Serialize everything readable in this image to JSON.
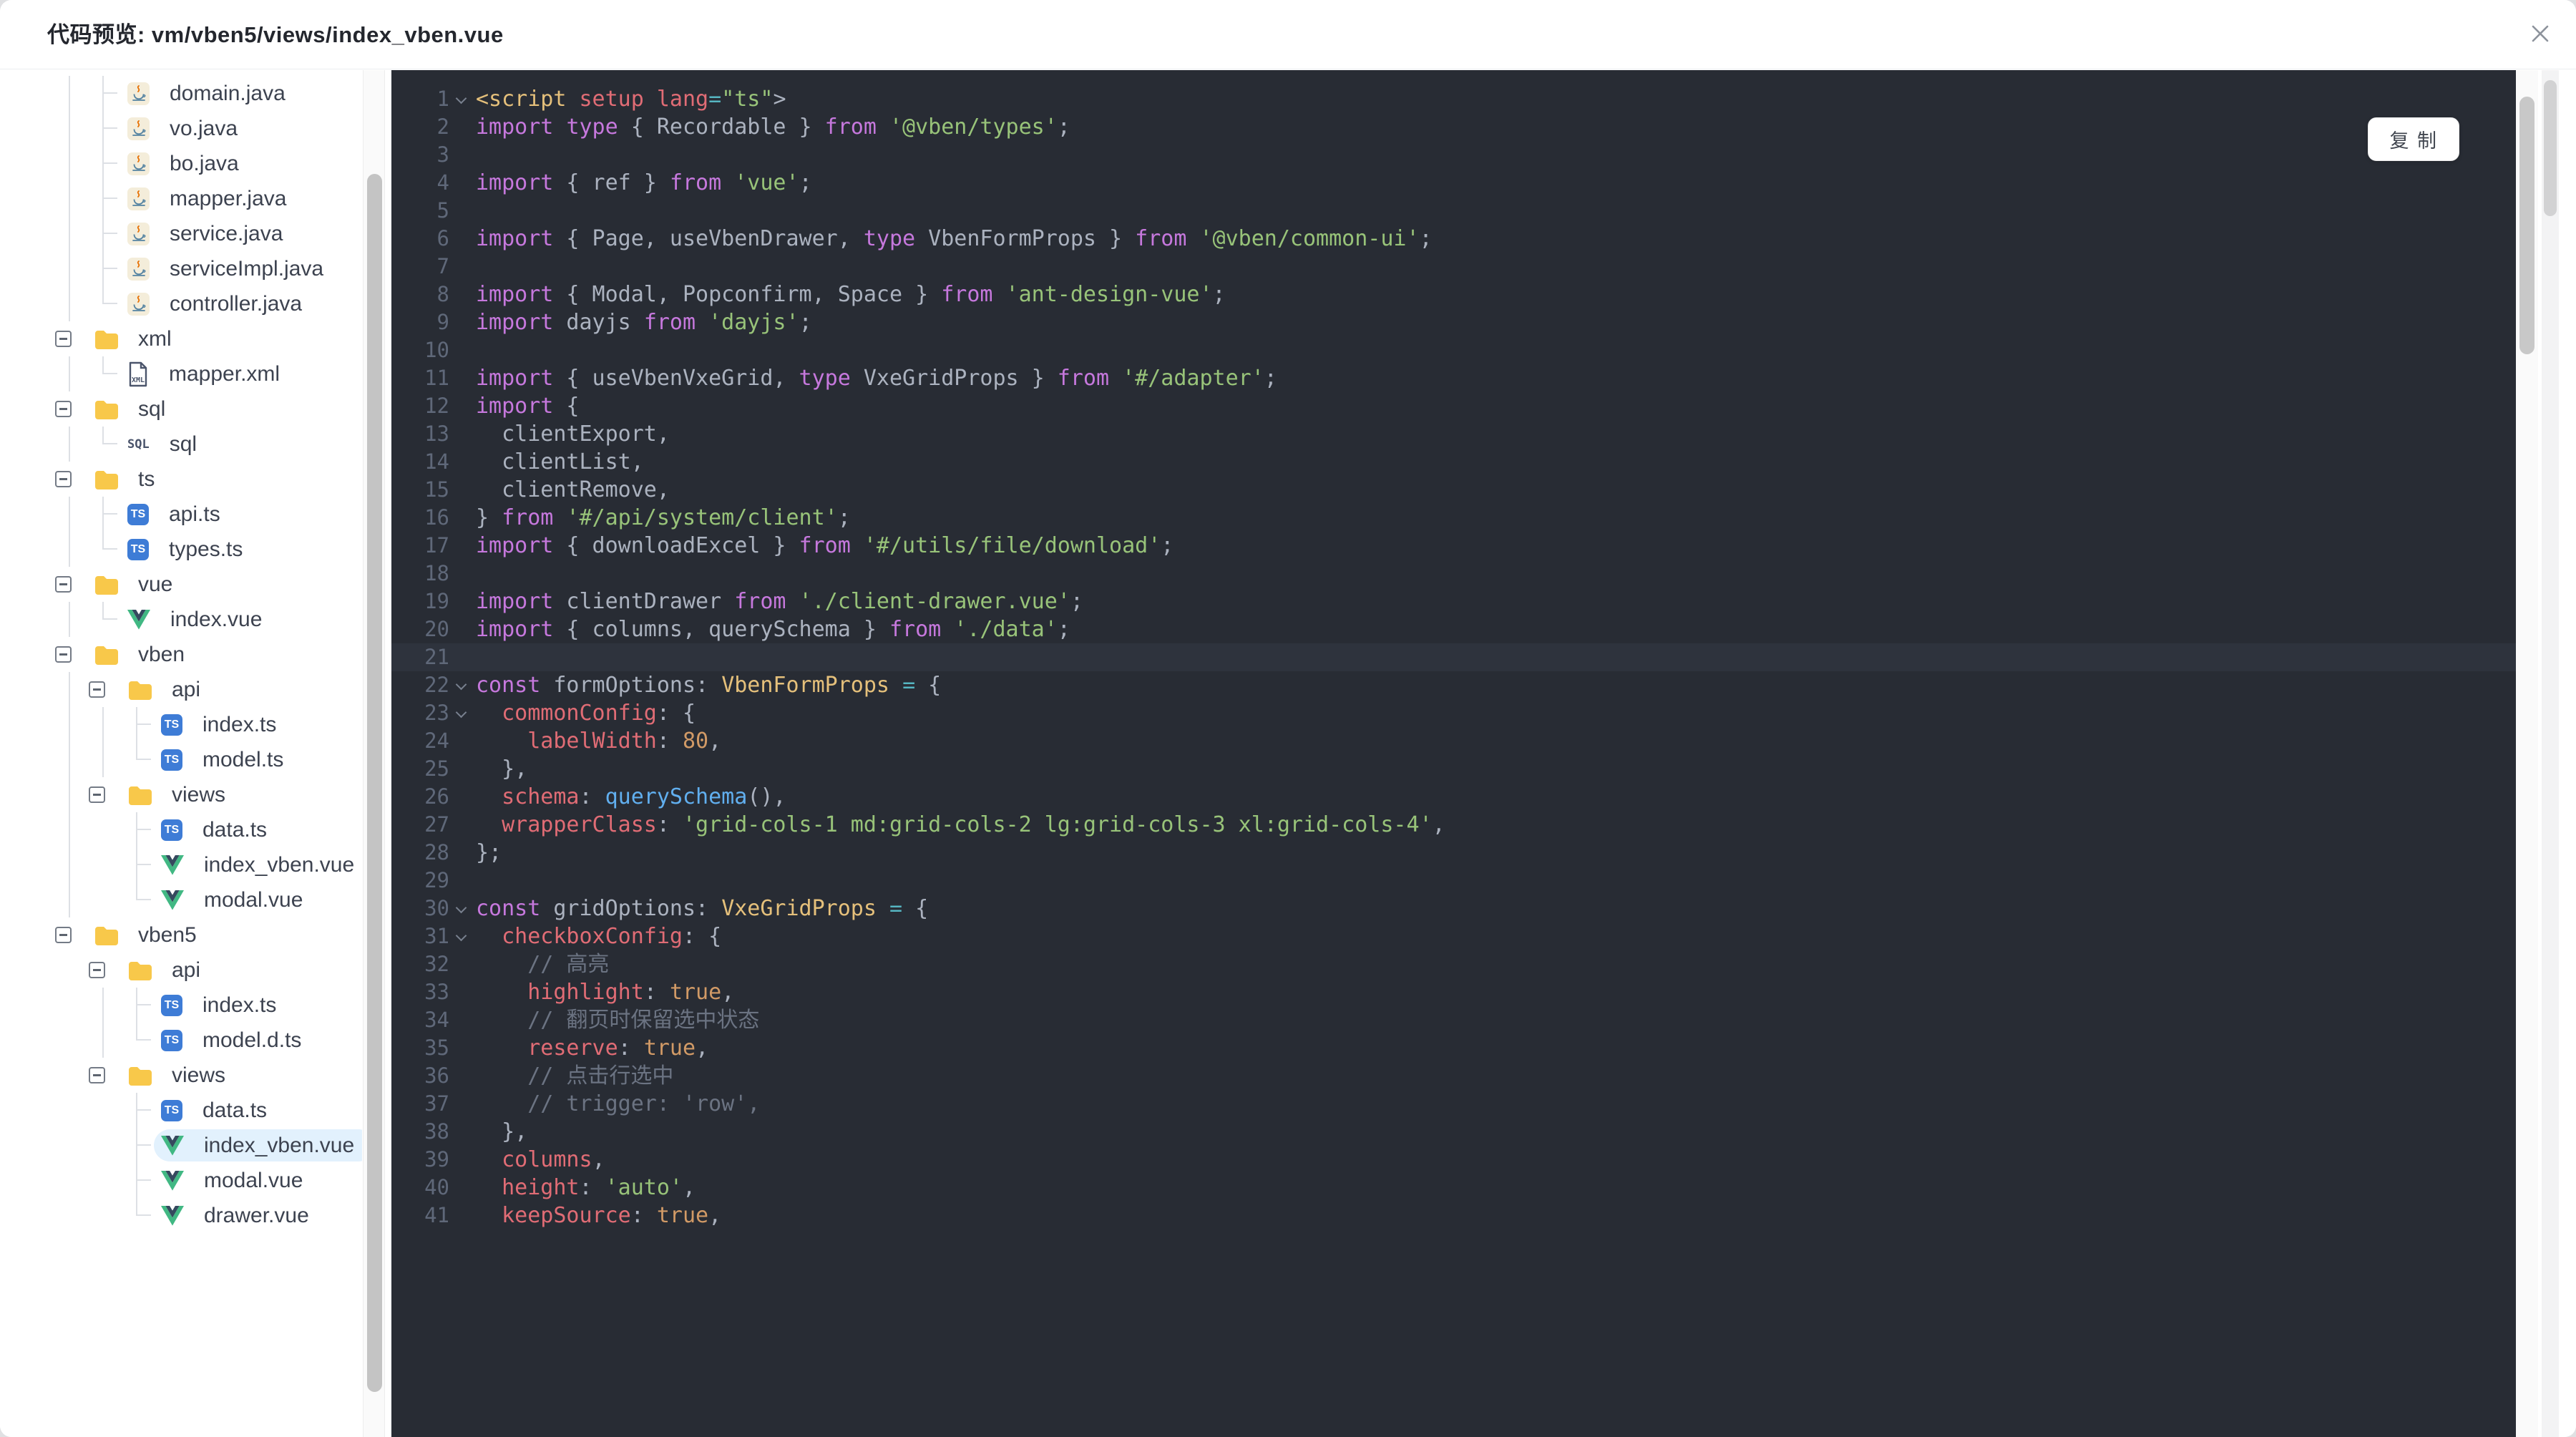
{
  "window": {
    "title": "代码预览: vm/vben5/views/index_vben.vue"
  },
  "colors": {
    "code_bg": "#282c34",
    "cursor_line_bg": "#2e333d",
    "line_number": "#5f6879",
    "keyword": "#c678dd",
    "string": "#98c379",
    "property": "#e06c75",
    "number": "#d19a66",
    "type": "#e5c07b",
    "function": "#61afef",
    "operator": "#56b6c2",
    "comment": "#6b7382",
    "default_text": "#abb2bf",
    "folder_icon": "#f8c84a",
    "ts_icon": "#3e7cd6",
    "vue_icon_green": "#41b883",
    "vue_icon_navy": "#35495e",
    "selected_row_bg": "#e2f1fd"
  },
  "tree": {
    "items": [
      {
        "label": "domain.java",
        "icon": "java-icon",
        "level": 1,
        "conn": "tee",
        "guides": [
          0
        ]
      },
      {
        "label": "vo.java",
        "icon": "java-icon",
        "level": 1,
        "conn": "tee",
        "guides": [
          0
        ]
      },
      {
        "label": "bo.java",
        "icon": "java-icon",
        "level": 1,
        "conn": "tee",
        "guides": [
          0
        ]
      },
      {
        "label": "mapper.java",
        "icon": "java-icon",
        "level": 1,
        "conn": "tee",
        "guides": [
          0
        ]
      },
      {
        "label": "service.java",
        "icon": "java-icon",
        "level": 1,
        "conn": "tee",
        "guides": [
          0
        ]
      },
      {
        "label": "serviceImpl.java",
        "icon": "java-icon",
        "level": 1,
        "conn": "tee",
        "guides": [
          0
        ]
      },
      {
        "label": "controller.java",
        "icon": "java-icon",
        "level": 1,
        "conn": "corner",
        "guides": [
          0
        ]
      },
      {
        "label": "xml",
        "icon": "folder-icon",
        "level": 0,
        "expander": true,
        "guides": []
      },
      {
        "label": "mapper.xml",
        "icon": "xml-icon",
        "level": 1,
        "conn": "corner",
        "guides": [
          0
        ]
      },
      {
        "label": "sql",
        "icon": "folder-icon",
        "level": 0,
        "expander": true,
        "guides": []
      },
      {
        "label": "sql",
        "icon": "sql-icon",
        "level": 1,
        "conn": "corner",
        "guides": [
          0
        ]
      },
      {
        "label": "ts",
        "icon": "folder-icon",
        "level": 0,
        "expander": true,
        "guides": []
      },
      {
        "label": "api.ts",
        "icon": "ts-icon",
        "level": 1,
        "conn": "tee",
        "guides": [
          0
        ]
      },
      {
        "label": "types.ts",
        "icon": "ts-icon",
        "level": 1,
        "conn": "corner",
        "guides": [
          0
        ]
      },
      {
        "label": "vue",
        "icon": "folder-icon",
        "level": 0,
        "expander": true,
        "guides": []
      },
      {
        "label": "index.vue",
        "icon": "vue-icon",
        "level": 1,
        "conn": "corner",
        "guides": [
          0
        ]
      },
      {
        "label": "vben",
        "icon": "folder-icon",
        "level": 0,
        "expander": true,
        "guides": []
      },
      {
        "label": "api",
        "icon": "folder-icon",
        "level": 1,
        "expander": true,
        "guides": [
          0
        ]
      },
      {
        "label": "index.ts",
        "icon": "ts-icon",
        "level": 2,
        "conn": "tee",
        "guides": [
          0,
          1
        ]
      },
      {
        "label": "model.ts",
        "icon": "ts-icon",
        "level": 2,
        "conn": "corner",
        "guides": [
          0,
          1
        ]
      },
      {
        "label": "views",
        "icon": "folder-icon",
        "level": 1,
        "expander": true,
        "guides": [
          0
        ]
      },
      {
        "label": "data.ts",
        "icon": "ts-icon",
        "level": 2,
        "conn": "tee",
        "guides": [
          0
        ]
      },
      {
        "label": "index_vben.vue",
        "icon": "vue-icon",
        "level": 2,
        "conn": "tee",
        "guides": [
          0
        ]
      },
      {
        "label": "modal.vue",
        "icon": "vue-icon",
        "level": 2,
        "conn": "corner",
        "guides": [
          0
        ]
      },
      {
        "label": "vben5",
        "icon": "folder-icon",
        "level": 0,
        "expander": true,
        "guides": []
      },
      {
        "label": "api",
        "icon": "folder-icon",
        "level": 1,
        "expander": true,
        "guides": []
      },
      {
        "label": "index.ts",
        "icon": "ts-icon",
        "level": 2,
        "conn": "tee",
        "guides": [
          1
        ]
      },
      {
        "label": "model.d.ts",
        "icon": "ts-icon",
        "level": 2,
        "conn": "corner",
        "guides": [
          1
        ]
      },
      {
        "label": "views",
        "icon": "folder-icon",
        "level": 1,
        "expander": true,
        "guides": []
      },
      {
        "label": "data.ts",
        "icon": "ts-icon",
        "level": 2,
        "conn": "tee",
        "guides": []
      },
      {
        "label": "index_vben.vue",
        "icon": "vue-icon",
        "level": 2,
        "conn": "tee",
        "guides": [],
        "selected": true
      },
      {
        "label": "modal.vue",
        "icon": "vue-icon",
        "level": 2,
        "conn": "tee",
        "guides": []
      },
      {
        "label": "drawer.vue",
        "icon": "vue-icon",
        "level": 2,
        "conn": "corner",
        "guides": []
      }
    ]
  },
  "code": {
    "copy_label": "复 制",
    "cursor_line": 21,
    "lines": [
      {
        "n": 1,
        "fold": true,
        "t": [
          [
            "g",
            "<script"
          ],
          [
            "w",
            " "
          ],
          [
            "p",
            "setup"
          ],
          [
            "w",
            " "
          ],
          [
            "p",
            "lang"
          ],
          [
            "o",
            "="
          ],
          [
            "s",
            "\"ts\""
          ],
          [
            "w",
            ">"
          ]
        ]
      },
      {
        "n": 2,
        "t": [
          [
            "k",
            "import"
          ],
          [
            "w",
            " "
          ],
          [
            "k",
            "type"
          ],
          [
            "w",
            " { Recordable } "
          ],
          [
            "k",
            "from"
          ],
          [
            "w",
            " "
          ],
          [
            "s",
            "'@vben/types'"
          ],
          [
            "w",
            ";"
          ]
        ]
      },
      {
        "n": 3,
        "t": []
      },
      {
        "n": 4,
        "t": [
          [
            "k",
            "import"
          ],
          [
            "w",
            " { ref } "
          ],
          [
            "k",
            "from"
          ],
          [
            "w",
            " "
          ],
          [
            "s",
            "'vue'"
          ],
          [
            "w",
            ";"
          ]
        ]
      },
      {
        "n": 5,
        "t": []
      },
      {
        "n": 6,
        "t": [
          [
            "k",
            "import"
          ],
          [
            "w",
            " { Page, useVbenDrawer, "
          ],
          [
            "k",
            "type"
          ],
          [
            "w",
            " VbenFormProps } "
          ],
          [
            "k",
            "from"
          ],
          [
            "w",
            " "
          ],
          [
            "s",
            "'@vben/common-ui'"
          ],
          [
            "w",
            ";"
          ]
        ]
      },
      {
        "n": 7,
        "t": []
      },
      {
        "n": 8,
        "t": [
          [
            "k",
            "import"
          ],
          [
            "w",
            " { Modal, Popconfirm, Space } "
          ],
          [
            "k",
            "from"
          ],
          [
            "w",
            " "
          ],
          [
            "s",
            "'ant-design-vue'"
          ],
          [
            "w",
            ";"
          ]
        ]
      },
      {
        "n": 9,
        "t": [
          [
            "k",
            "import"
          ],
          [
            "w",
            " dayjs "
          ],
          [
            "k",
            "from"
          ],
          [
            "w",
            " "
          ],
          [
            "s",
            "'dayjs'"
          ],
          [
            "w",
            ";"
          ]
        ]
      },
      {
        "n": 10,
        "t": []
      },
      {
        "n": 11,
        "t": [
          [
            "k",
            "import"
          ],
          [
            "w",
            " { useVbenVxeGrid, "
          ],
          [
            "k",
            "type"
          ],
          [
            "w",
            " VxeGridProps } "
          ],
          [
            "k",
            "from"
          ],
          [
            "w",
            " "
          ],
          [
            "s",
            "'#/adapter'"
          ],
          [
            "w",
            ";"
          ]
        ]
      },
      {
        "n": 12,
        "t": [
          [
            "k",
            "import"
          ],
          [
            "w",
            " {"
          ]
        ]
      },
      {
        "n": 13,
        "t": [
          [
            "w",
            "  clientExport,"
          ]
        ]
      },
      {
        "n": 14,
        "t": [
          [
            "w",
            "  clientList,"
          ]
        ]
      },
      {
        "n": 15,
        "t": [
          [
            "w",
            "  clientRemove,"
          ]
        ]
      },
      {
        "n": 16,
        "t": [
          [
            "w",
            "} "
          ],
          [
            "k",
            "from"
          ],
          [
            "w",
            " "
          ],
          [
            "s",
            "'#/api/system/client'"
          ],
          [
            "w",
            ";"
          ]
        ]
      },
      {
        "n": 17,
        "t": [
          [
            "k",
            "import"
          ],
          [
            "w",
            " { downloadExcel } "
          ],
          [
            "k",
            "from"
          ],
          [
            "w",
            " "
          ],
          [
            "s",
            "'#/utils/file/download'"
          ],
          [
            "w",
            ";"
          ]
        ]
      },
      {
        "n": 18,
        "t": []
      },
      {
        "n": 19,
        "t": [
          [
            "k",
            "import"
          ],
          [
            "w",
            " clientDrawer "
          ],
          [
            "k",
            "from"
          ],
          [
            "w",
            " "
          ],
          [
            "s",
            "'./client-drawer.vue'"
          ],
          [
            "w",
            ";"
          ]
        ]
      },
      {
        "n": 20,
        "t": [
          [
            "k",
            "import"
          ],
          [
            "w",
            " { columns, querySchema } "
          ],
          [
            "k",
            "from"
          ],
          [
            "w",
            " "
          ],
          [
            "s",
            "'./data'"
          ],
          [
            "w",
            ";"
          ]
        ]
      },
      {
        "n": 21,
        "t": []
      },
      {
        "n": 22,
        "fold": true,
        "t": [
          [
            "k",
            "const"
          ],
          [
            "w",
            " formOptions: "
          ],
          [
            "t",
            "VbenFormProps"
          ],
          [
            "w",
            " "
          ],
          [
            "o",
            "="
          ],
          [
            "w",
            " {"
          ]
        ]
      },
      {
        "n": 23,
        "fold": true,
        "t": [
          [
            "w",
            "  "
          ],
          [
            "p",
            "commonConfig"
          ],
          [
            "w",
            ": {"
          ]
        ]
      },
      {
        "n": 24,
        "t": [
          [
            "w",
            "    "
          ],
          [
            "p",
            "labelWidth"
          ],
          [
            "w",
            ": "
          ],
          [
            "n",
            "80"
          ],
          [
            "w",
            ","
          ]
        ]
      },
      {
        "n": 25,
        "t": [
          [
            "w",
            "  },"
          ]
        ]
      },
      {
        "n": 26,
        "t": [
          [
            "w",
            "  "
          ],
          [
            "p",
            "schema"
          ],
          [
            "w",
            ": "
          ],
          [
            "f",
            "querySchema"
          ],
          [
            "w",
            "(),"
          ]
        ]
      },
      {
        "n": 27,
        "t": [
          [
            "w",
            "  "
          ],
          [
            "p",
            "wrapperClass"
          ],
          [
            "w",
            ": "
          ],
          [
            "s",
            "'grid-cols-1 md:grid-cols-2 lg:grid-cols-3 xl:grid-cols-4'"
          ],
          [
            "w",
            ","
          ]
        ]
      },
      {
        "n": 28,
        "t": [
          [
            "w",
            "};"
          ]
        ]
      },
      {
        "n": 29,
        "t": []
      },
      {
        "n": 30,
        "fold": true,
        "t": [
          [
            "k",
            "const"
          ],
          [
            "w",
            " gridOptions: "
          ],
          [
            "t",
            "VxeGridProps"
          ],
          [
            "w",
            " "
          ],
          [
            "o",
            "="
          ],
          [
            "w",
            " {"
          ]
        ]
      },
      {
        "n": 31,
        "fold": true,
        "t": [
          [
            "w",
            "  "
          ],
          [
            "p",
            "checkboxConfig"
          ],
          [
            "w",
            ": {"
          ]
        ]
      },
      {
        "n": 32,
        "t": [
          [
            "c",
            "    // 高亮"
          ]
        ]
      },
      {
        "n": 33,
        "t": [
          [
            "w",
            "    "
          ],
          [
            "p",
            "highlight"
          ],
          [
            "w",
            ": "
          ],
          [
            "n",
            "true"
          ],
          [
            "w",
            ","
          ]
        ]
      },
      {
        "n": 34,
        "t": [
          [
            "c",
            "    // 翻页时保留选中状态"
          ]
        ]
      },
      {
        "n": 35,
        "t": [
          [
            "w",
            "    "
          ],
          [
            "p",
            "reserve"
          ],
          [
            "w",
            ": "
          ],
          [
            "n",
            "true"
          ],
          [
            "w",
            ","
          ]
        ]
      },
      {
        "n": 36,
        "t": [
          [
            "c",
            "    // 点击行选中"
          ]
        ]
      },
      {
        "n": 37,
        "t": [
          [
            "c",
            "    // trigger: 'row',"
          ]
        ]
      },
      {
        "n": 38,
        "t": [
          [
            "w",
            "  },"
          ]
        ]
      },
      {
        "n": 39,
        "t": [
          [
            "w",
            "  "
          ],
          [
            "p",
            "columns"
          ],
          [
            "w",
            ","
          ]
        ]
      },
      {
        "n": 40,
        "t": [
          [
            "w",
            "  "
          ],
          [
            "p",
            "height"
          ],
          [
            "w",
            ": "
          ],
          [
            "s",
            "'auto'"
          ],
          [
            "w",
            ","
          ]
        ]
      },
      {
        "n": 41,
        "t": [
          [
            "w",
            "  "
          ],
          [
            "p",
            "keepSource"
          ],
          [
            "w",
            ": "
          ],
          [
            "n",
            "true"
          ],
          [
            "w",
            ","
          ]
        ]
      }
    ]
  }
}
